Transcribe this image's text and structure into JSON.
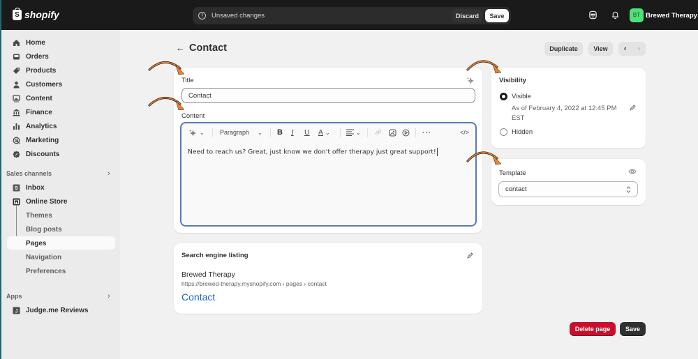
{
  "topbar": {
    "brand": "shopify",
    "unsaved_message": "Unsaved changes",
    "discard_label": "Discard",
    "save_label": "Save",
    "avatar_initials": "BT",
    "store_name": "Brewed Therapy",
    "avatar_color": "#4fe077"
  },
  "sidebar": {
    "items": [
      {
        "label": "Home",
        "icon": "home-icon"
      },
      {
        "label": "Orders",
        "icon": "inbox-tray-icon"
      },
      {
        "label": "Products",
        "icon": "tag-icon"
      },
      {
        "label": "Customers",
        "icon": "person-icon"
      },
      {
        "label": "Content",
        "icon": "image-icon"
      },
      {
        "label": "Finance",
        "icon": "bank-icon"
      },
      {
        "label": "Analytics",
        "icon": "bar-chart-icon"
      },
      {
        "label": "Marketing",
        "icon": "target-icon"
      },
      {
        "label": "Discounts",
        "icon": "discount-icon"
      }
    ],
    "sales_channels_label": "Sales channels",
    "channels": [
      {
        "label": "Inbox",
        "icon": "inbox-app-icon"
      },
      {
        "label": "Online Store",
        "icon": "store-icon"
      }
    ],
    "online_store_sub": [
      "Themes",
      "Blog posts",
      "Pages",
      "Navigation",
      "Preferences"
    ],
    "active_sub": "Pages",
    "apps_label": "Apps",
    "apps": [
      {
        "label": "Judge.me Reviews",
        "icon": "judgeme-icon"
      }
    ]
  },
  "header": {
    "title": "Contact",
    "duplicate_label": "Duplicate",
    "view_label": "View",
    "prev_glyph": "‹",
    "next_glyph": "›"
  },
  "page_form": {
    "title_label": "Title",
    "title_value": "Contact",
    "content_label": "Content",
    "toolbar": {
      "format_value": "Paragraph"
    },
    "content_text": "Need to reach us? Great, just know we don't offer therapy just great support!"
  },
  "seo": {
    "heading": "Search engine listing",
    "store_name": "Brewed Therapy",
    "url": "https://brewed-therapy.myshopify.com › pages › contact",
    "page_title": "Contact"
  },
  "visibility": {
    "heading": "Visibility",
    "options": [
      {
        "label": "Visible",
        "selected": true
      },
      {
        "label": "Hidden",
        "selected": false
      }
    ],
    "visible_note_line1": "As of February 4, 2022 at 12:45 PM",
    "visible_note_line2": "EST"
  },
  "template": {
    "heading": "Template",
    "value": "contact"
  },
  "footer": {
    "delete_label": "Delete page",
    "save_label": "Save",
    "delete_color": "#c8102e"
  },
  "annotations": {
    "arrow_color": "#f07f2e"
  }
}
